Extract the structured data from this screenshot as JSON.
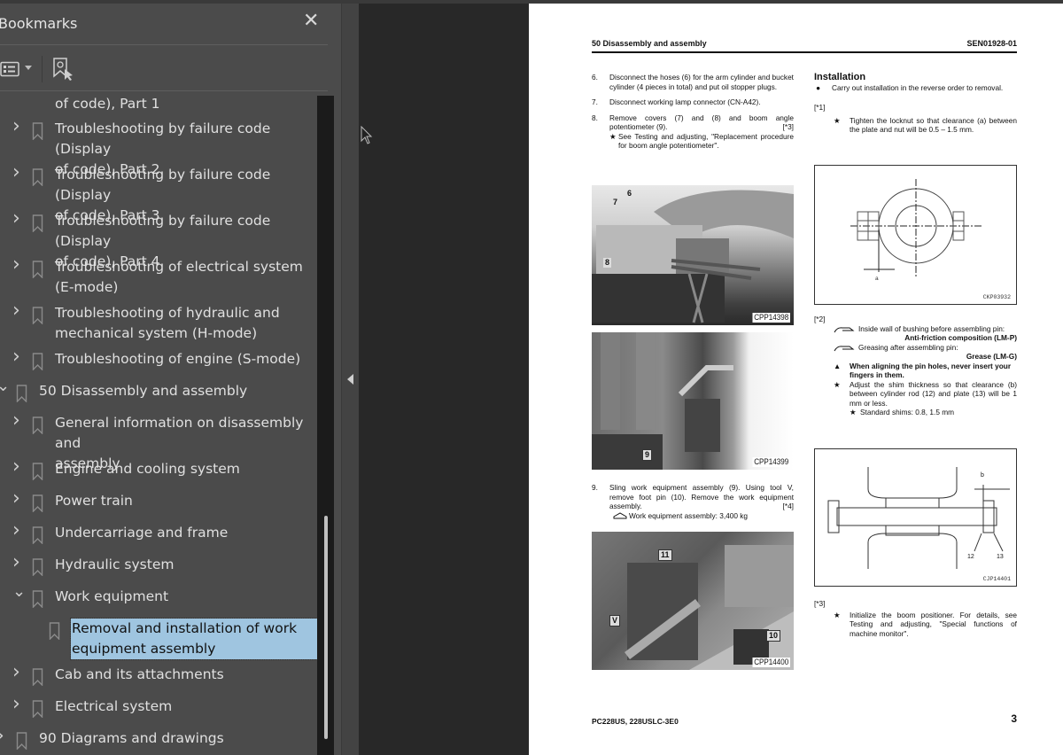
{
  "sidebar": {
    "title": "Bookmarks",
    "close_icon": "close-icon",
    "toolbar": {
      "options_icon": "list-options-icon",
      "find_bookmark_icon": "find-current-bookmark-icon"
    },
    "items": [
      {
        "level": 1,
        "label_line1": "of code), Part 1",
        "label_line2": "",
        "expanded": null,
        "partial": true
      },
      {
        "level": 1,
        "label_line1": "Troubleshooting by failure code (Display",
        "label_line2": "of code), Part 2",
        "expanded": false
      },
      {
        "level": 1,
        "label_line1": "Troubleshooting by failure code (Display",
        "label_line2": "of code), Part 3",
        "expanded": false
      },
      {
        "level": 1,
        "label_line1": "Troubleshooting by failure code (Display",
        "label_line2": "of code), Part 4",
        "expanded": false
      },
      {
        "level": 1,
        "label_line1": "Troubleshooting of electrical system",
        "label_line2": "(E-mode)",
        "expanded": false
      },
      {
        "level": 1,
        "label_line1": "Troubleshooting of hydraulic and",
        "label_line2": "mechanical system (H-mode)",
        "expanded": false
      },
      {
        "level": 1,
        "label_line1": "Troubleshooting of engine (S-mode)",
        "label_line2": "",
        "expanded": false
      },
      {
        "level": 0,
        "label_line1": "50 Disassembly and assembly",
        "label_line2": "",
        "expanded": true
      },
      {
        "level": 1,
        "label_line1": "General information on disassembly and",
        "label_line2": "assembly",
        "expanded": false
      },
      {
        "level": 1,
        "label_line1": "Engine and cooling system",
        "label_line2": "",
        "expanded": false
      },
      {
        "level": 1,
        "label_line1": "Power train",
        "label_line2": "",
        "expanded": false
      },
      {
        "level": 1,
        "label_line1": "Undercarriage and frame",
        "label_line2": "",
        "expanded": false
      },
      {
        "level": 1,
        "label_line1": "Hydraulic system",
        "label_line2": "",
        "expanded": false
      },
      {
        "level": 1,
        "label_line1": "Work equipment",
        "label_line2": "",
        "expanded": true
      },
      {
        "level": 2,
        "label_line1": "Removal and installation of work",
        "label_line2": "equipment assembly",
        "expanded": null,
        "selected": true
      },
      {
        "level": 1,
        "label_line1": "Cab and its attachments",
        "label_line2": "",
        "expanded": false
      },
      {
        "level": 1,
        "label_line1": "Electrical system",
        "label_line2": "",
        "expanded": false
      },
      {
        "level": 0,
        "label_line1": "90 Diagrams and drawings",
        "label_line2": "",
        "expanded": false
      }
    ]
  },
  "page": {
    "header_left": "50 Disassembly and assembly",
    "header_right": "SEN01928-01",
    "steps": [
      {
        "num": "6.",
        "text": "Disconnect the hoses (6) for the arm cylinder and bucket cylinder (4 pieces in total) and put oil stopper plugs."
      },
      {
        "num": "7.",
        "text": "Disconnect working lamp connector (CN-A42)."
      },
      {
        "num": "8.",
        "text": "Remove covers (7) and (8) and boom angle potentiometer (9).",
        "ref": "[*3]",
        "note": "See Testing and adjusting, \"Replacement procedure for boom angle potentiometer\"."
      },
      {
        "num": "9.",
        "text": "Sling work equipment assembly (9). Using tool V, remove foot pin (10). Remove the work equipment assembly.",
        "ref": "[*4]",
        "weight_note": "Work equipment assembly: 3,400 kg"
      }
    ],
    "photos": [
      {
        "caption": "CPP14398",
        "callouts": [
          "6",
          "7",
          "8"
        ]
      },
      {
        "caption": "CPP14399",
        "callouts": [
          "9"
        ]
      },
      {
        "caption": "CPP14400",
        "callouts": [
          "11",
          "V",
          "10"
        ]
      }
    ],
    "installation": {
      "title": "Installation",
      "bullet": "Carry out installation in the reverse order to removal.",
      "ref1": "[*1]",
      "ref1_note": "Tighten the locknut so that clearance (a) between the plate and nut will be 0.5 – 1.5 mm.",
      "fig1_caption": "CKP03932",
      "fig1_label": "a",
      "ref2": "[*2]",
      "ref2_lube1": "Inside wall of bushing before assembling pin:",
      "ref2_lube1_value": "Anti-friction composition (LM-P)",
      "ref2_lube2": "Greasing after assembling pin:",
      "ref2_lube2_value": "Grease (LM-G)",
      "ref2_warning": "When aligning the pin holes, never insert your fingers in them.",
      "ref2_note": "Adjust the shim thickness so that clearance (b) between cylinder rod (12) and plate (13) will be 1 mm or less.",
      "ref2_subnote": "Standard shims: 0.8, 1.5 mm",
      "fig2_caption": "CJP14401",
      "fig2_labels": [
        "b",
        "12",
        "13"
      ],
      "ref3": "[*3]",
      "ref3_note": "Initialize the boom positioner. For details, see Testing and adjusting, \"Special functions of machine monitor\"."
    },
    "footer_left": "PC228US, 228USLC-3E0",
    "page_number": "3"
  }
}
